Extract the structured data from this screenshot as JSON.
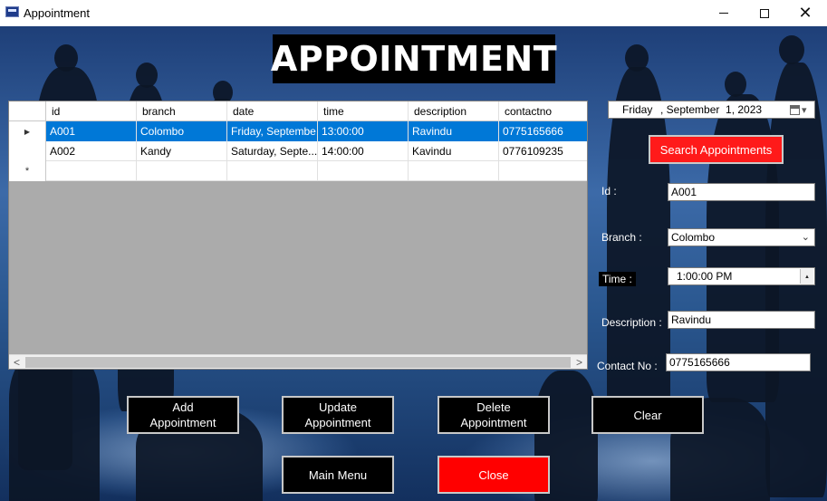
{
  "window": {
    "title": "Appointment",
    "controls": {
      "minimize": "—",
      "maximize": "☐",
      "close": "✕"
    }
  },
  "header": {
    "title": "APPOINTMENT"
  },
  "grid": {
    "columns": [
      "id",
      "branch",
      "date",
      "time",
      "description",
      "contactno"
    ],
    "rows": [
      {
        "id": "A001",
        "branch": "Colombo",
        "date": "Friday, Septembe...",
        "time": "13:00:00",
        "description": "Ravindu",
        "contactno": "0775165666",
        "selected": true
      },
      {
        "id": "A002",
        "branch": "Kandy",
        "date": "Saturday, Septe...",
        "time": "14:00:00",
        "description": "Kavindu",
        "contactno": "0776109235",
        "selected": false
      }
    ],
    "current_row_marker": "▶",
    "new_row_marker": "*",
    "scroll_left": "<",
    "scroll_right": ">"
  },
  "form": {
    "date_picker": {
      "day": "Friday",
      "month_day": ", September  1, 2023",
      "dropdown": "▾"
    },
    "search_label": "Search Appointments",
    "id_label": "Id :",
    "id_value": "A001",
    "branch_label": "Branch :",
    "branch_value": "Colombo",
    "branch_arrow": "⌄",
    "time_label": "Time :",
    "time_value": "1:00:00 PM",
    "spin_up": "▲",
    "spin_down": "▼",
    "description_label": "Description :",
    "description_value": "Ravindu",
    "contact_label": "Contact No :",
    "contact_value": "0775165666"
  },
  "buttons": {
    "add_line1": "Add",
    "add_line2": "Appointment",
    "update_line1": "Update",
    "update_line2": "Appointment",
    "delete_line1": "Delete",
    "delete_line2": "Appointment",
    "clear": "Clear",
    "main_menu": "Main Menu",
    "close": "Close"
  },
  "colors": {
    "accent_red": "#ff0000",
    "selection_blue": "#0078d7",
    "title_bg": "#000000"
  }
}
